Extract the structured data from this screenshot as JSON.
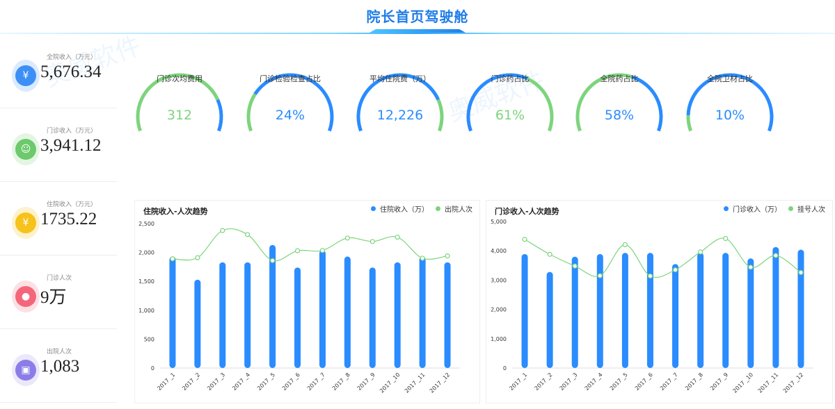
{
  "header": {
    "title": "院长首页驾驶舱"
  },
  "watermark": {
    "text": "奥威软件",
    "sub": "Ourway Power"
  },
  "colors": {
    "blue": "#2a8cff",
    "green": "#7dd47d",
    "title": "#1e7ce8"
  },
  "sidebar": {
    "items": [
      {
        "label": "全院收入（万元）",
        "value": "5,676.34",
        "icon": "money-bag-icon",
        "color": "#3d8ff5",
        "ring": "#dbeaff"
      },
      {
        "label": "门诊收入（万元）",
        "value": "3,941.12",
        "icon": "doctor-icon",
        "color": "#6cc96c",
        "ring": "#e3f5e3"
      },
      {
        "label": "住院收入（万元）",
        "value": "1735.22",
        "icon": "clipboard-yuan-icon",
        "color": "#f7c21c",
        "ring": "#fdf2cc"
      },
      {
        "label": "门诊人次",
        "value": "9万",
        "icon": "people-icon",
        "color": "#f4677a",
        "ring": "#fde0e4"
      },
      {
        "label": "出院人次",
        "value": "1,083",
        "icon": "discharge-icon",
        "color": "#8b7de8",
        "ring": "#ebe8fb"
      }
    ]
  },
  "gauges": [
    {
      "label": "门诊次均费用",
      "value": "312",
      "split": 0.8,
      "first": "#7dd47d",
      "second": "#2a8cff",
      "value_color": "#7dd47d"
    },
    {
      "label": "门诊检验检查占比",
      "value": "24%",
      "split": 0.24,
      "first": "#7dd47d",
      "second": "#2a8cff",
      "value_color": "#2a8cff"
    },
    {
      "label": "平均住院费（万）",
      "value": "12,226",
      "split": 0.8,
      "first": "#2a8cff",
      "second": "#7dd47d",
      "value_color": "#2a8cff"
    },
    {
      "label": "门诊药占比",
      "value": "61%",
      "split": 0.61,
      "first": "#2a8cff",
      "second": "#7dd47d",
      "value_color": "#7dd47d"
    },
    {
      "label": "全院药占比",
      "value": "58%",
      "split": 0.58,
      "first": "#7dd47d",
      "second": "#2a8cff",
      "value_color": "#2a8cff"
    },
    {
      "label": "全院卫材占比",
      "value": "10%",
      "split": 0.1,
      "first": "#7dd47d",
      "second": "#2a8cff",
      "value_color": "#2a8cff"
    }
  ],
  "chart_data": [
    {
      "type": "bar",
      "title": "住院收入-人次趋势",
      "categories": [
        "2017_1",
        "2017_2",
        "2017_3",
        "2017_4",
        "2017_5",
        "2017_6",
        "2017_7",
        "2017_8",
        "2017_9",
        "2017_10",
        "2017_11",
        "2017_12"
      ],
      "ylim": [
        0,
        2500
      ],
      "yticks": [
        "0",
        "500",
        "1,000",
        "1,500",
        "2,000",
        "2,500"
      ],
      "legend": "top-right",
      "grid": false,
      "series": [
        {
          "name": "住院收入（万）",
          "type": "bar",
          "color": "#2a8cff",
          "values": [
            1930,
            1530,
            1830,
            1830,
            2130,
            1740,
            2040,
            1930,
            1740,
            1830,
            1930,
            1830
          ]
        },
        {
          "name": "出院人次",
          "type": "line",
          "color": "#7dd47d",
          "values": [
            1890,
            1910,
            2380,
            2310,
            1860,
            2030,
            2035,
            2250,
            2190,
            2265,
            1900,
            1940
          ]
        }
      ]
    },
    {
      "type": "bar",
      "title": "门诊收入-人次趋势",
      "categories": [
        "2017_1",
        "2017_2",
        "2017_3",
        "2017_4",
        "2017_5",
        "2017_6",
        "2017_7",
        "2017_8",
        "2017_9",
        "2017_10",
        "2017_11",
        "2017_12"
      ],
      "ylim": [
        0,
        5000
      ],
      "yticks": [
        "0",
        "1,000",
        "2,000",
        "3,000",
        "4,000",
        "5,000"
      ],
      "legend": "top-right",
      "grid": false,
      "series": [
        {
          "name": "门诊收入（万）",
          "type": "bar",
          "color": "#2a8cff",
          "values": [
            3890,
            3280,
            3800,
            3890,
            3930,
            3930,
            3550,
            3930,
            3930,
            3740,
            4130,
            4040
          ]
        },
        {
          "name": "挂号人次",
          "type": "line",
          "color": "#7dd47d",
          "values": [
            4390,
            3880,
            3480,
            3150,
            4210,
            3140,
            3350,
            3960,
            4420,
            3440,
            3840,
            3260
          ]
        }
      ]
    }
  ]
}
